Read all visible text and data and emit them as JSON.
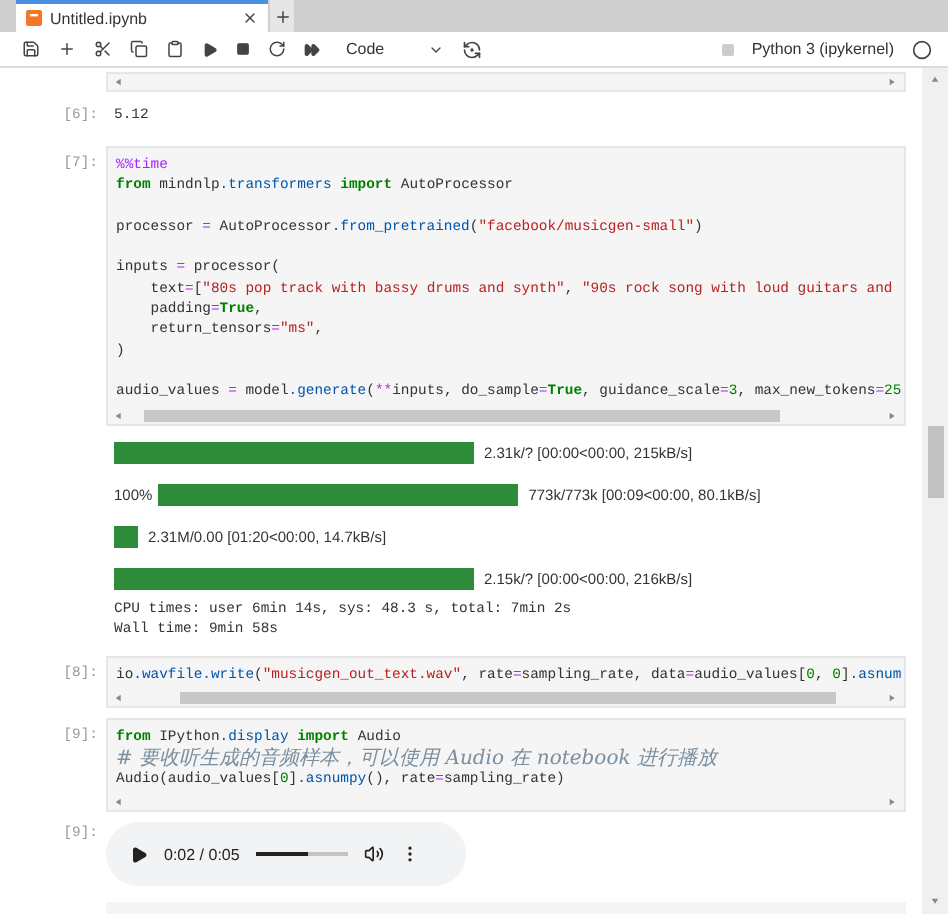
{
  "tabs": [
    {
      "label": "Untitled.ipynb",
      "selected": true
    }
  ],
  "toolbar": {
    "cell_type": "Code",
    "kernel": "Python 3 (ipykernel)"
  },
  "cells": [
    {
      "kind": "text_output",
      "prompt": "[6]:",
      "text": "5.12"
    },
    {
      "kind": "code",
      "prompt": "[7]:",
      "scroll": true,
      "lines": [
        {
          "kind": "code",
          "tokens": [
            {
              "kind": "magic",
              "text": "%%time"
            }
          ]
        },
        {
          "kind": "code",
          "tokens": [
            {
              "kind": "kw",
              "text": "from"
            },
            {
              "kind": "t",
              "text": " mindnlp"
            },
            {
              "kind": "attr",
              "text": ".transformers"
            },
            {
              "kind": "kw",
              "text": " import"
            },
            {
              "kind": "t",
              "text": " AutoProcessor"
            }
          ]
        },
        {
          "kind": "blank"
        },
        {
          "kind": "code",
          "tokens": [
            {
              "kind": "t",
              "text": "processor "
            },
            {
              "kind": "op",
              "text": "="
            },
            {
              "kind": "t",
              "text": " AutoProcessor"
            },
            {
              "kind": "attr",
              "text": ".from_pretrained"
            },
            {
              "kind": "t",
              "text": "("
            },
            {
              "kind": "str",
              "text": "\"facebook/musicgen-small\""
            },
            {
              "kind": "t",
              "text": ")"
            }
          ]
        },
        {
          "kind": "blank"
        },
        {
          "kind": "code",
          "tokens": [
            {
              "kind": "t",
              "text": "inputs "
            },
            {
              "kind": "op",
              "text": "="
            },
            {
              "kind": "t",
              "text": " processor("
            }
          ]
        },
        {
          "kind": "code",
          "tokens": [
            {
              "kind": "t",
              "text": "    text"
            },
            {
              "kind": "op",
              "text": "="
            },
            {
              "kind": "t",
              "text": "["
            },
            {
              "kind": "str",
              "text": "\"80s pop track with bassy drums and synth\""
            },
            {
              "kind": "t",
              "text": ", "
            },
            {
              "kind": "str",
              "text": "\"90s rock song with loud guitars and"
            }
          ]
        },
        {
          "kind": "code",
          "tokens": [
            {
              "kind": "t",
              "text": "    padding"
            },
            {
              "kind": "op",
              "text": "="
            },
            {
              "kind": "kw",
              "text": "True"
            },
            {
              "kind": "t",
              "text": ","
            }
          ]
        },
        {
          "kind": "code",
          "tokens": [
            {
              "kind": "t",
              "text": "    return_tensors"
            },
            {
              "kind": "op",
              "text": "="
            },
            {
              "kind": "str",
              "text": "\"ms\""
            },
            {
              "kind": "t",
              "text": ","
            }
          ]
        },
        {
          "kind": "code",
          "tokens": [
            {
              "kind": "t",
              "text": ")"
            }
          ]
        },
        {
          "kind": "blank"
        },
        {
          "kind": "code",
          "tokens": [
            {
              "kind": "t",
              "text": "audio_values "
            },
            {
              "kind": "op",
              "text": "="
            },
            {
              "kind": "t",
              "text": " model"
            },
            {
              "kind": "attr",
              "text": ".generate"
            },
            {
              "kind": "t",
              "text": "("
            },
            {
              "kind": "op",
              "text": "**"
            },
            {
              "kind": "t",
              "text": "inputs, do_sample"
            },
            {
              "kind": "op",
              "text": "="
            },
            {
              "kind": "kw",
              "text": "True"
            },
            {
              "kind": "t",
              "text": ", guidance_scale"
            },
            {
              "kind": "op",
              "text": "="
            },
            {
              "kind": "num",
              "text": "3"
            },
            {
              "kind": "t",
              "text": ", max_new_tokens"
            },
            {
              "kind": "op",
              "text": "="
            },
            {
              "kind": "num",
              "text": "25"
            }
          ]
        }
      ]
    },
    {
      "kind": "progress_output",
      "bars": [
        {
          "kind": "bar",
          "complete": true,
          "text": "2.31k/? [00:00<00:00,  215kB/s]"
        },
        {
          "kind": "bar",
          "complete": true,
          "prefix": "100%",
          "text": "773k/773k [00:09<00:00,  80.1kB/s]"
        },
        {
          "kind": "indeterminate",
          "complete": true,
          "text": "2.31M/0.00 [01:20<00:00,  14.7kB/s]"
        },
        {
          "kind": "bar",
          "complete": true,
          "text": "2.15k/? [00:00<00:00,  216kB/s]"
        }
      ],
      "lines": [
        "CPU times: user 6min 14s, sys: 48.3 s, total: 7min 2s",
        "Wall time: 9min 58s"
      ]
    },
    {
      "kind": "code",
      "prompt": "[8]:",
      "scroll": true,
      "lines": [
        {
          "kind": "code",
          "tokens": [
            {
              "kind": "t",
              "text": "io"
            },
            {
              "kind": "attr",
              "text": ".wavfile.write"
            },
            {
              "kind": "t",
              "text": "("
            },
            {
              "kind": "str",
              "text": "\"musicgen_out_text.wav\""
            },
            {
              "kind": "t",
              "text": ", rate"
            },
            {
              "kind": "op",
              "text": "="
            },
            {
              "kind": "t",
              "text": "sampling_rate, data"
            },
            {
              "kind": "op",
              "text": "="
            },
            {
              "kind": "t",
              "text": "audio_values["
            },
            {
              "kind": "num",
              "text": "0"
            },
            {
              "kind": "t",
              "text": ", "
            },
            {
              "kind": "num",
              "text": "0"
            },
            {
              "kind": "t",
              "text": "]"
            },
            {
              "kind": "attr",
              "text": ".asnum"
            }
          ]
        }
      ]
    },
    {
      "kind": "code",
      "prompt": "[9]:",
      "scroll": false,
      "lines": [
        {
          "kind": "code",
          "tokens": [
            {
              "kind": "kw",
              "text": "from"
            },
            {
              "kind": "t",
              "text": " IPython"
            },
            {
              "kind": "attr",
              "text": ".display"
            },
            {
              "kind": "kw",
              "text": " import"
            },
            {
              "kind": "t",
              "text": " Audio"
            }
          ]
        },
        {
          "kind": "code",
          "tokens": [
            {
              "kind": "comment",
              "text": "# 要收听生成的音频样本，可以使用 Audio 在 notebook 进行播放"
            }
          ]
        },
        {
          "kind": "code",
          "tokens": [
            {
              "kind": "t",
              "text": "Audio(audio_values["
            },
            {
              "kind": "num",
              "text": "0"
            },
            {
              "kind": "t",
              "text": "]"
            },
            {
              "kind": "attr",
              "text": ".asnumpy"
            },
            {
              "kind": "t",
              "text": "(), rate"
            },
            {
              "kind": "op",
              "text": "="
            },
            {
              "kind": "t",
              "text": "sampling_rate)"
            }
          ]
        }
      ]
    },
    {
      "kind": "audio_output",
      "prompt": "[9]:",
      "time": "0:02 / 0:05",
      "level": 0.57
    }
  ]
}
